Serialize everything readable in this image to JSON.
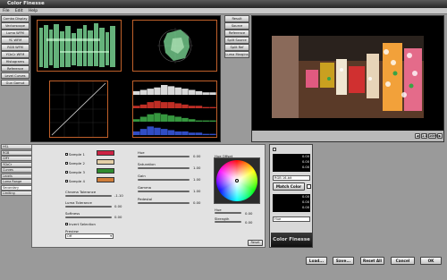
{
  "window": {
    "title": "Color Finesse"
  },
  "menu": [
    "File",
    "Edit",
    "Help"
  ],
  "left_scope_buttons": [
    "Combo Display",
    "Vectorscope",
    "Luma WFM",
    "YC WFM",
    "RGB WFM",
    "YCbCr WFM",
    "Histograms",
    "Reference",
    "Level Curves",
    "Gun Gamut"
  ],
  "right_view_buttons": [
    "Result",
    "Source",
    "Reference",
    "Split Source",
    "Split Ref",
    "Luma Margins"
  ],
  "color_tab_labels": [
    "HSL",
    "RGB",
    "CMY",
    "YCbCr",
    "Curves",
    "Levels",
    "Luma Range",
    "Secondary",
    "Limiting"
  ],
  "secondary": {
    "samples": [
      "Sample 1",
      "Sample 2",
      "Sample 3",
      "Sample 4"
    ],
    "sample_colors": [
      "#cc2244",
      "#e4d0a8",
      "#2f8a2f",
      "#d07e3a"
    ],
    "chroma_tolerance": "Chroma Tolerance",
    "chroma_tolerance_val": "-1.10",
    "luma_tolerance": "Luma Tolerance",
    "luma_tolerance_val": "0.00",
    "softness": "Softness",
    "softness_val": "0.00",
    "invert_selection": "Invert Selection",
    "preview": "Preview",
    "preview_value": "Off"
  },
  "adjust": [
    {
      "label": "Hue",
      "value": "0.00"
    },
    {
      "label": "Saturation",
      "value": "1.00"
    },
    {
      "label": "Gain",
      "value": "1.00"
    },
    {
      "label": "Gamma",
      "value": "1.00"
    },
    {
      "label": "Pedestal",
      "value": "0.00"
    }
  ],
  "hue_offset": {
    "label": "Hue Offset",
    "hue_label": "Hue",
    "hue_val": "0.00",
    "strength_label": "Strength",
    "strength_val": "0.00"
  },
  "reset_label": "Reset",
  "match": {
    "color_mode": "RGB 16-bit",
    "button": "Match Color",
    "mode_bottom": "Hue",
    "top_values": [
      "0.00",
      "0.00",
      "0.00"
    ],
    "bottom_values": [
      "0.00",
      "0.00",
      "0.00"
    ]
  },
  "logo": "Color Finesse",
  "bottom_buttons": [
    "Load...",
    "Save...",
    "Reset All",
    "Cancel",
    "OK"
  ],
  "preview_toolbar": [
    "◀",
    "1:1",
    "100%",
    "▶"
  ],
  "colors": {
    "accent": "#c0602a",
    "window_bg": "#9a9a9a"
  },
  "chart_data": {
    "type": "area",
    "title": "",
    "note": "Histogram panel: luma, red, green, blue channels (no printed values)",
    "series": [
      {
        "name": "",
        "values": [
          3,
          4,
          5,
          6,
          8,
          7,
          6,
          5,
          4,
          3,
          2,
          2
        ]
      },
      {
        "name": "",
        "values": [
          2,
          3,
          5,
          6,
          5,
          5,
          4,
          3,
          2,
          2,
          1,
          1
        ]
      },
      {
        "name": "",
        "values": [
          2,
          4,
          6,
          7,
          6,
          5,
          4,
          3,
          2,
          1,
          1,
          1
        ]
      },
      {
        "name": "",
        "values": [
          3,
          5,
          7,
          6,
          5,
          4,
          3,
          3,
          2,
          2,
          1,
          1
        ]
      }
    ]
  }
}
